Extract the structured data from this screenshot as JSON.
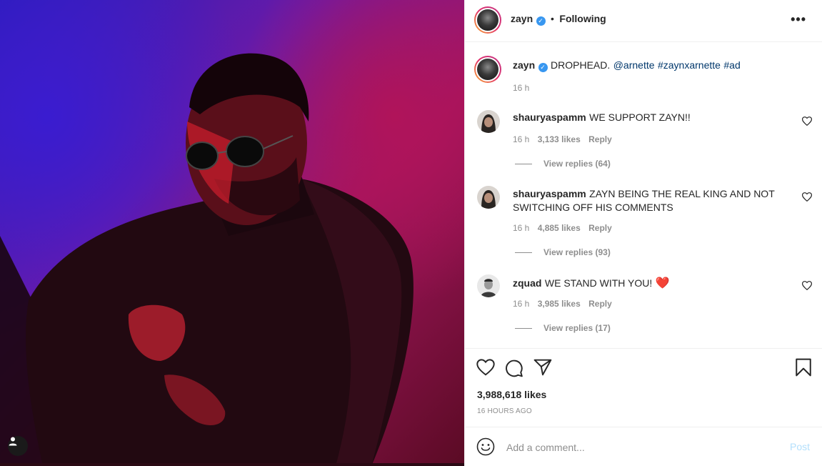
{
  "post": {
    "author": "zayn",
    "verified_icon": "verified-badge-icon",
    "separator": "•",
    "follow_state": "Following",
    "more_icon": "•••"
  },
  "caption": {
    "author": "zayn",
    "text": "DROPHEAD.",
    "mention": "@arnette",
    "hashtags": [
      "#zaynxarnette",
      "#ad"
    ],
    "time": "16 h"
  },
  "comments": [
    {
      "user": "shauryaspamm",
      "text": "WE SUPPORT ZAYN!!",
      "time": "16 h",
      "likes": "3,133 likes",
      "reply_label": "Reply",
      "view_replies": "View replies (64)"
    },
    {
      "user": "shauryaspamm",
      "text": "ZAYN BEING THE REAL KING AND NOT SWITCHING OFF HIS COMMENTS",
      "time": "16 h",
      "likes": "4,885 likes",
      "reply_label": "Reply",
      "view_replies": "View replies (93)"
    },
    {
      "user": "zquad",
      "text": "WE STAND WITH YOU!",
      "emoji": "❤️",
      "time": "16 h",
      "likes": "3,985 likes",
      "reply_label": "Reply",
      "view_replies": "View replies (17)"
    }
  ],
  "actions": {
    "likes_count": "3,988,618 likes",
    "posted_ago": "16 HOURS AGO"
  },
  "compose": {
    "placeholder": "Add a comment...",
    "post_label": "Post"
  },
  "colors": {
    "text": "#262626",
    "secondary": "#8e8e8e",
    "link": "#00376b",
    "verified": "#3897f0",
    "post_disabled": "#b2dffc",
    "heart_red": "#ed4956"
  }
}
